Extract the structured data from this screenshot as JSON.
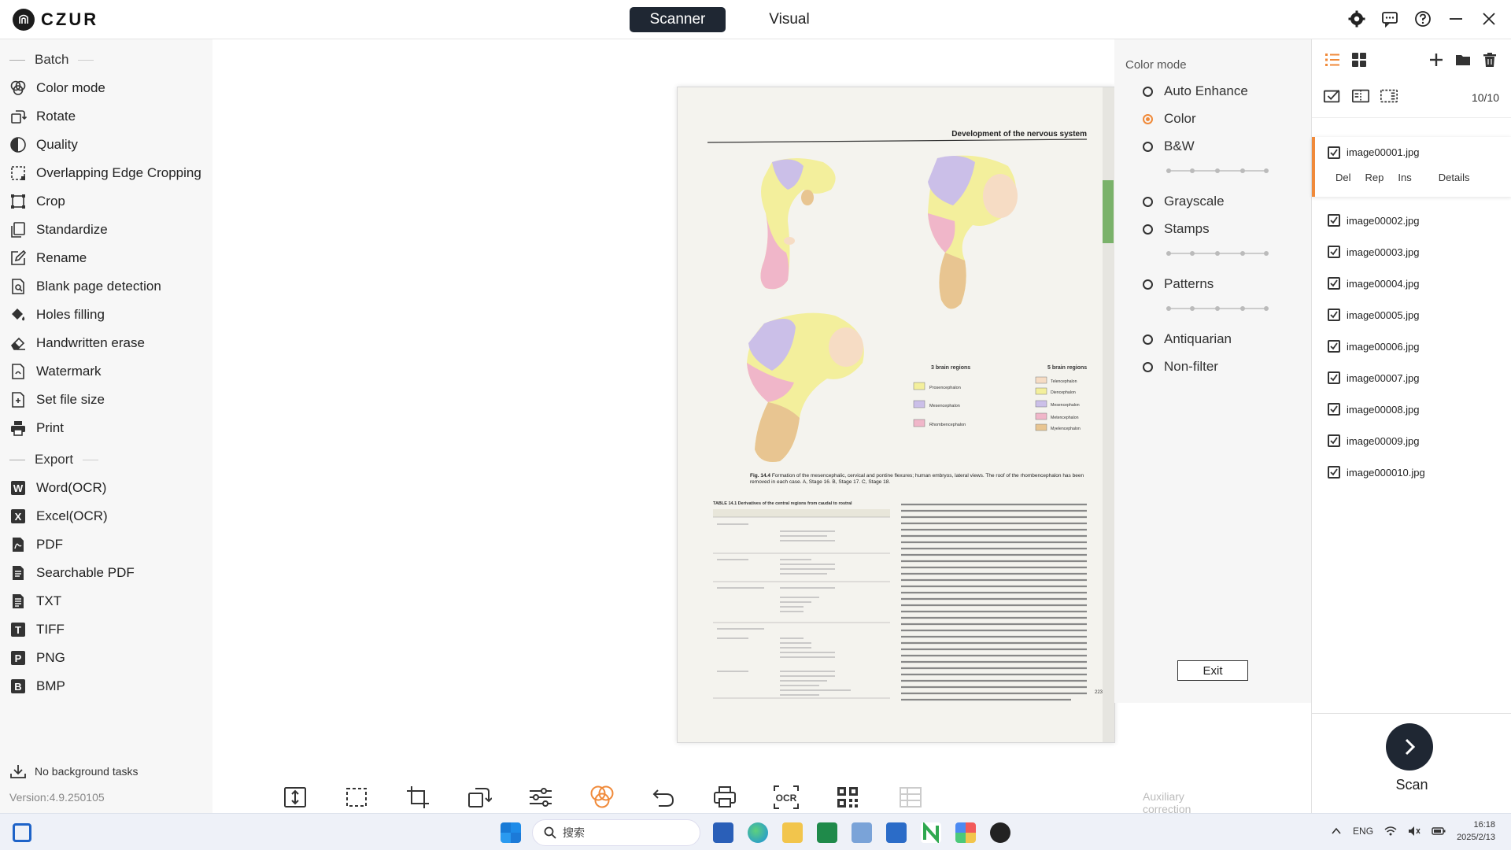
{
  "app": {
    "logo_text": "CZUR"
  },
  "modes": [
    {
      "label": "Scanner",
      "active": true
    },
    {
      "label": "Visual",
      "active": false
    }
  ],
  "window_controls": [
    "gear-icon",
    "chat-icon",
    "help-icon",
    "minimize-icon",
    "close-icon"
  ],
  "left_panel": {
    "batch_label": "Batch",
    "batch_items": [
      {
        "label": "Color mode",
        "icon": "color-mode-icon"
      },
      {
        "label": "Rotate",
        "icon": "rotate-icon"
      },
      {
        "label": "Quality",
        "icon": "quality-icon"
      },
      {
        "label": "Overlapping Edge Cropping",
        "icon": "edge-crop-icon"
      },
      {
        "label": "Crop",
        "icon": "crop-icon"
      },
      {
        "label": "Standardize",
        "icon": "standardize-icon"
      },
      {
        "label": "Rename",
        "icon": "rename-icon"
      },
      {
        "label": "Blank page detection",
        "icon": "blank-page-icon"
      },
      {
        "label": "Holes filling",
        "icon": "holes-filling-icon"
      },
      {
        "label": "Handwritten erase",
        "icon": "eraser-icon"
      },
      {
        "label": "Watermark",
        "icon": "watermark-icon"
      },
      {
        "label": "Set file size",
        "icon": "file-size-icon"
      },
      {
        "label": "Print",
        "icon": "print-icon"
      }
    ],
    "export_label": "Export",
    "export_items": [
      {
        "label": "Word(OCR)",
        "icon": "word-icon",
        "badge": "W"
      },
      {
        "label": "Excel(OCR)",
        "icon": "excel-icon",
        "badge": "X"
      },
      {
        "label": "PDF",
        "icon": "pdf-icon",
        "badge": ""
      },
      {
        "label": "Searchable PDF",
        "icon": "searchable-pdf-icon",
        "badge": ""
      },
      {
        "label": "TXT",
        "icon": "txt-icon",
        "badge": ""
      },
      {
        "label": "TIFF",
        "icon": "tiff-icon",
        "badge": "T"
      },
      {
        "label": "PNG",
        "icon": "png-icon",
        "badge": "P"
      },
      {
        "label": "BMP",
        "icon": "bmp-icon",
        "badge": "B"
      }
    ],
    "background_tasks": "No background tasks",
    "version": "Version:4.9.250105"
  },
  "color_panel": {
    "title": "Color mode",
    "options": [
      {
        "label": "Auto Enhance",
        "selected": false
      },
      {
        "label": "Color",
        "selected": true
      },
      {
        "label": "B&W",
        "selected": false
      },
      {
        "label": "Grayscale",
        "selected": false
      },
      {
        "label": "Stamps",
        "selected": false
      },
      {
        "label": "Patterns",
        "selected": false
      },
      {
        "label": "Antiquarian",
        "selected": false
      },
      {
        "label": "Non-filter",
        "selected": false
      }
    ],
    "exit_label": "Exit"
  },
  "right_panel": {
    "page_count": "10/10",
    "selected_actions": [
      "Del",
      "Rep",
      "Ins",
      "Details"
    ],
    "files": [
      "image00001.jpg",
      "image00002.jpg",
      "image00003.jpg",
      "image00004.jpg",
      "image00005.jpg",
      "image00006.jpg",
      "image00007.jpg",
      "image00008.jpg",
      "image00009.jpg",
      "image000010.jpg"
    ],
    "scan_label": "Scan"
  },
  "bottom_toolbar": {
    "tools": [
      "fit-height-icon",
      "select-area-icon",
      "crop-tool-icon",
      "rotate-tool-icon",
      "adjust-icon",
      "color-filter-icon",
      "undo-icon",
      "print-tool-icon",
      "ocr-icon",
      "qr-code-icon"
    ],
    "ocr_text": "OCR",
    "auxiliary_label": "Auxiliary correction"
  },
  "document": {
    "header": "Development of the nervous system",
    "caption_bold": "Fig. 14.4",
    "caption": "Formation of the mesencephalic, cervical and pontine flexures; human embryos, lateral views. The roof of the rhombencephalon has been removed in each case. A, Stage 16. B, Stage 17. C, Stage 18.",
    "table_title": "TABLE 14.1 Derivatives of the central regions from caudal to rostral",
    "legend_left_title": "3 brain regions",
    "legend_right_title": "5 brain regions",
    "legend_left": [
      "Prosencephalon",
      "Mesencephalon",
      "Rhombencephalon"
    ],
    "legend_right": [
      "Telencephalon",
      "Diencephalon",
      "Mesencephalon",
      "Metencephalon",
      "Myelencephalon"
    ],
    "page_number": "223",
    "colors": {
      "yellow": "#f3ef9c",
      "purple": "#cbbfe8",
      "pink": "#f0b6c9",
      "tan": "#e8c591",
      "peach": "#f6dcc4"
    }
  },
  "taskbar": {
    "search_placeholder": "搜索",
    "lang": "ENG",
    "time": "16:18",
    "date": "2025/2/13"
  },
  "colors": {
    "accent": "#f08a3a",
    "dark": "#1f2733"
  }
}
